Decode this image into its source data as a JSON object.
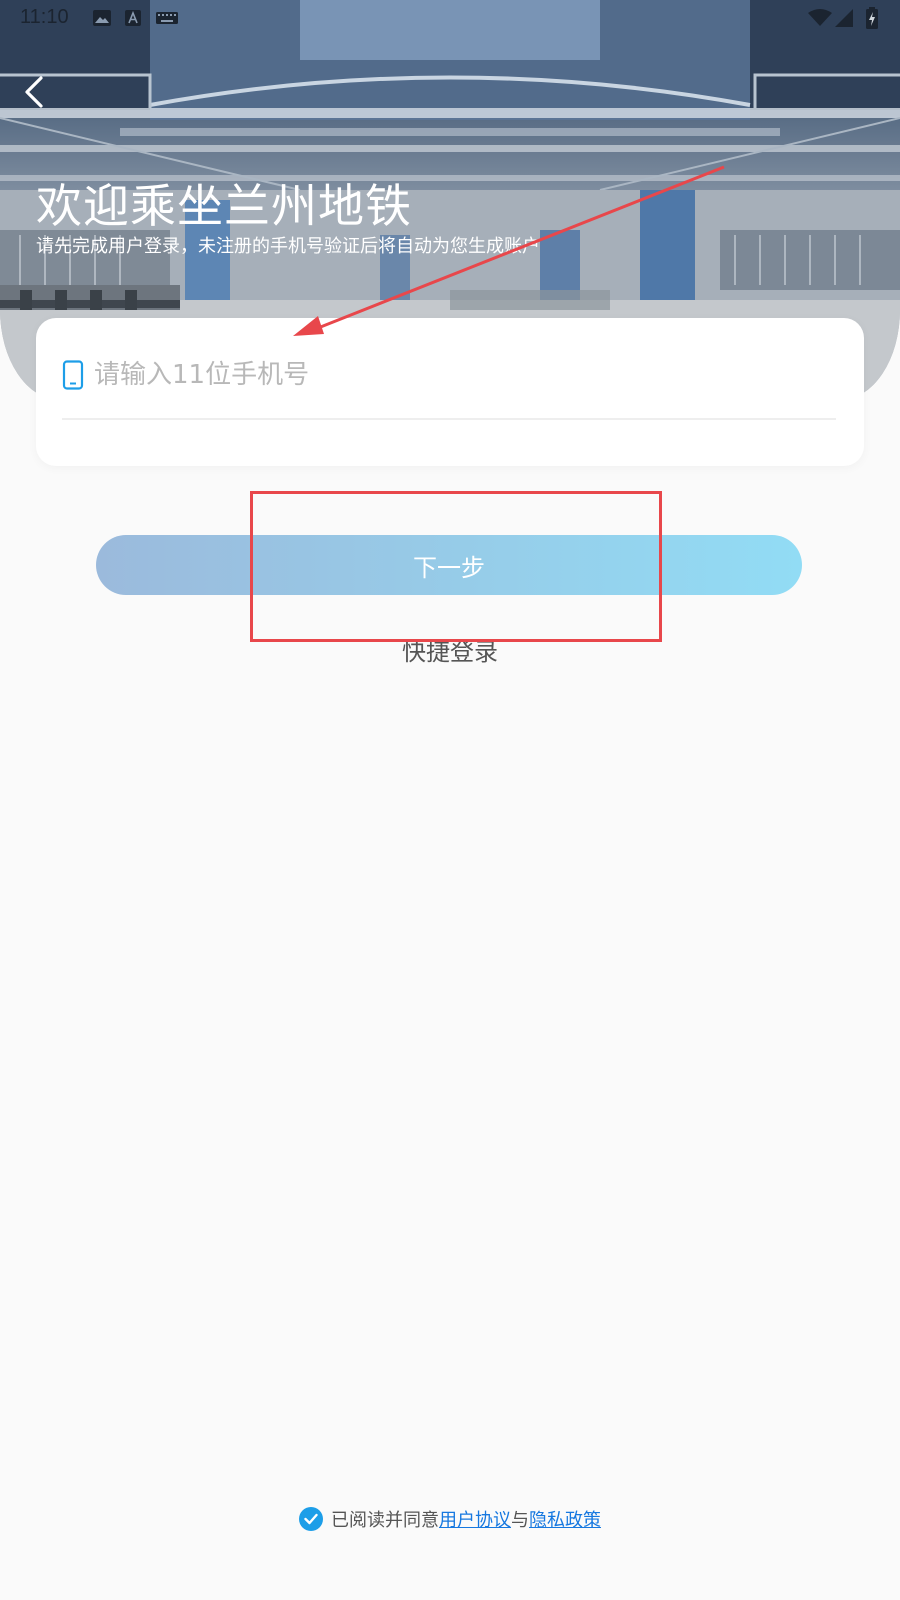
{
  "status_bar": {
    "time": "11:10"
  },
  "header": {
    "title": "欢迎乘坐兰州地铁",
    "subtitle": "请先完成用户登录，未注册的手机号验证后将自动为您生成账户"
  },
  "phone_field": {
    "placeholder": "请输入11位手机号",
    "value": ""
  },
  "actions": {
    "next_label": "下一步",
    "quick_login_label": "快捷登录"
  },
  "agreement": {
    "checked": true,
    "prefix": "已阅读并同意",
    "user_agreement": "用户协议",
    "conjunction": "与",
    "privacy_policy": "隐私政策"
  },
  "icons": {
    "back": "chevron-left-icon",
    "phone": "smartphone-icon",
    "check": "checkmark-circle-icon"
  },
  "colors": {
    "accent": "#1d9ee8",
    "link": "#1678e0",
    "button_gradient_start": "#9bbadc",
    "button_gradient_end": "#92dcf5",
    "annotation": "#e8474b"
  }
}
